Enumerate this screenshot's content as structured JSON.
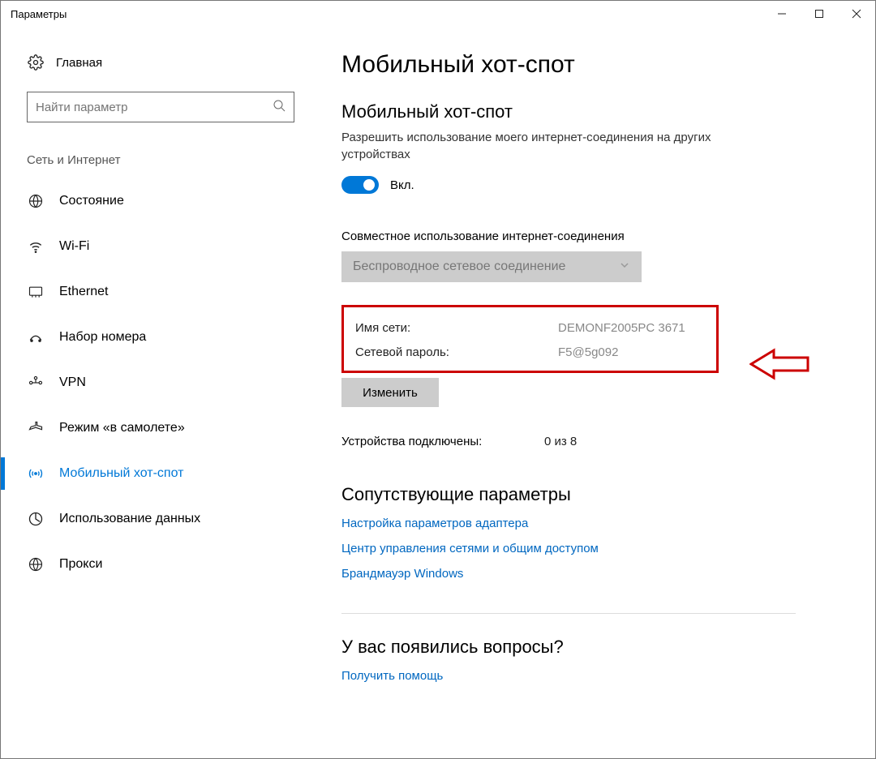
{
  "window": {
    "title": "Параметры"
  },
  "sidebar": {
    "home": "Главная",
    "search_placeholder": "Найти параметр",
    "group": "Сеть и Интернет",
    "items": [
      {
        "label": "Состояние"
      },
      {
        "label": "Wi-Fi"
      },
      {
        "label": "Ethernet"
      },
      {
        "label": "Набор номера"
      },
      {
        "label": "VPN"
      },
      {
        "label": "Режим «в самолете»"
      },
      {
        "label": "Мобильный хот-спот",
        "active": true
      },
      {
        "label": "Использование данных"
      },
      {
        "label": "Прокси"
      }
    ]
  },
  "main": {
    "page_title": "Мобильный хот-спот",
    "hotspot": {
      "heading": "Мобильный хот-спот",
      "desc": "Разрешить использование моего интернет-соединения на других устройствах",
      "toggle_state": "Вкл."
    },
    "share": {
      "label": "Совместное использование интернет-соединения",
      "value": "Беспроводное сетевое соединение"
    },
    "network": {
      "name_label": "Имя сети:",
      "name_value": "DEMONF2005PC 3671",
      "pass_label": "Сетевой пароль:",
      "pass_value": "F5@5g092",
      "edit": "Изменить"
    },
    "devices": {
      "label": "Устройства подключены:",
      "value": "0 из 8"
    },
    "related": {
      "heading": "Сопутствующие параметры",
      "links": [
        "Настройка параметров адаптера",
        "Центр управления сетями и общим доступом",
        "Брандмауэр Windows"
      ]
    },
    "help": {
      "heading": "У вас появились вопросы?",
      "link": "Получить помощь"
    }
  }
}
